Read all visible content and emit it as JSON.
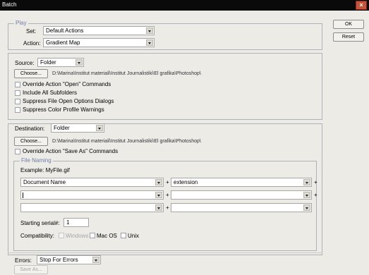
{
  "window": {
    "title": "Batch"
  },
  "buttons": {
    "ok": "OK",
    "reset": "Reset"
  },
  "play": {
    "legend": "Play",
    "set_label": "Set:",
    "set_value": "Default Actions",
    "action_label": "Action:",
    "action_value": "Gradient Map"
  },
  "source": {
    "label": "Source:",
    "value": "Folder",
    "choose": "Choose...",
    "path": "D:\\Marina\\Institut materiali\\Institut Journalistiki\\El grafika\\Photoshop\\",
    "options": [
      "Override Action \"Open\" Commands",
      "Include All Subfolders",
      "Suppress File Open Options Dialogs",
      "Suppress Color Profile Warnings"
    ]
  },
  "destination": {
    "label": "Destination:",
    "value": "Folder",
    "choose": "Choose...",
    "path": "D:\\Marina\\Institut materiali\\Institut Journalistiki\\El grafika\\Photoshop\\",
    "override": "Override Action \"Save As\" Commands"
  },
  "file_naming": {
    "legend": "File Naming",
    "example": "Example: MyFile.gif",
    "fields": [
      "Document Name",
      "extension",
      "",
      "",
      "",
      ""
    ],
    "plus": "+",
    "serial_label": "Starting serial#:",
    "serial_value": "1",
    "compat_label": "Compatibility:",
    "compat": [
      "Windows",
      "Mac OS",
      "Unix"
    ]
  },
  "errors": {
    "label": "Errors:",
    "value": "Stop For Errors",
    "save_as": "Save As..."
  }
}
